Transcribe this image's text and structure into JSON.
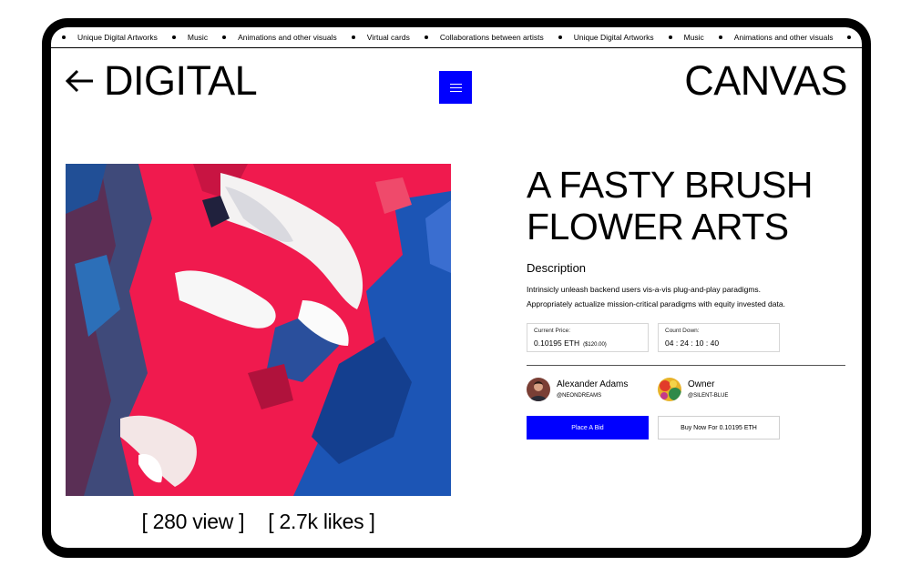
{
  "marquee": {
    "items": [
      "Unique Digital Artworks",
      "Music",
      "Animations and other visuals",
      "Virtual cards",
      "Collaborations between artists",
      "Unique Digital Artworks",
      "Music",
      "Animations and other visuals"
    ]
  },
  "header": {
    "brand_left": "DIGITAL",
    "brand_right": "CANVAS"
  },
  "artwork": {
    "views": "[ 280 view ]",
    "likes": "[ 2.7k likes ]"
  },
  "details": {
    "title_line1": "A FASTY BRUSH",
    "title_line2": "FLOWER ARTS",
    "description_heading": "Description",
    "description_line1": "Intrinsicly unleash backend users vis-a-vis plug-and-play paradigms.",
    "description_line2": "Appropriately actualize mission-critical paradigms with equity invested data.",
    "price_label": "Current Price:",
    "price_value": "0.10195 ETH",
    "price_usd": "($120.00)",
    "countdown_label": "Count Down:",
    "countdown_value": "04 : 24 : 10 : 40"
  },
  "creator": {
    "name": "Alexander Adams",
    "handle": "@NEONDREAMS"
  },
  "owner": {
    "name": "Owner",
    "handle": "@SILENT-BLUE"
  },
  "actions": {
    "bid_label": "Place A Bid",
    "buy_label": "Buy Now For 0.10195 ETH"
  },
  "colors": {
    "accent": "#0000ff",
    "frame": "#000000"
  }
}
